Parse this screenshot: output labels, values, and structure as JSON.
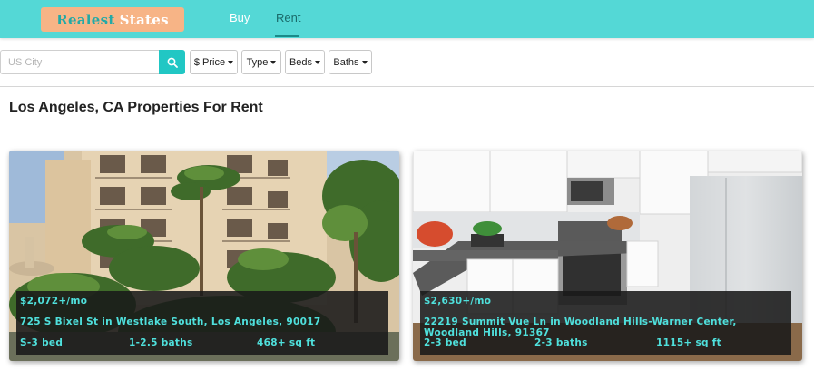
{
  "navbar": {
    "logo_word1": "Realest",
    "logo_word2": "States",
    "links": [
      {
        "label": "Buy",
        "active": false
      },
      {
        "label": "Rent",
        "active": true
      }
    ]
  },
  "search": {
    "placeholder": "US City",
    "value": "",
    "icon": "search-icon"
  },
  "filters": [
    {
      "label": "$ Price"
    },
    {
      "label": "Type"
    },
    {
      "label": "Beds"
    },
    {
      "label": "Baths"
    }
  ],
  "page_title": "Los Angeles, CA Properties For Rent",
  "listings": [
    {
      "price": "$2,072+/mo",
      "address": "725 S Bixel St in Westlake South, Los Angeles, 90017",
      "beds": "S-3 bed",
      "baths": "1-2.5 baths",
      "sqft": "468+ sq ft",
      "photo": "apartment-courtyard-exterior"
    },
    {
      "price": "$2,630+/mo",
      "address": "22219 Summit Vue Ln in Woodland Hills-Warner Center, Woodland Hills, 91367",
      "beds": "2-3 bed",
      "baths": "2-3 baths",
      "sqft": "1115+ sq ft",
      "photo": "kitchen-interior"
    }
  ],
  "colors": {
    "navbar": "#54d8d6",
    "logo_bg": "#f7b486",
    "accent": "#21c7c4",
    "card_text": "#4fe0dc"
  }
}
